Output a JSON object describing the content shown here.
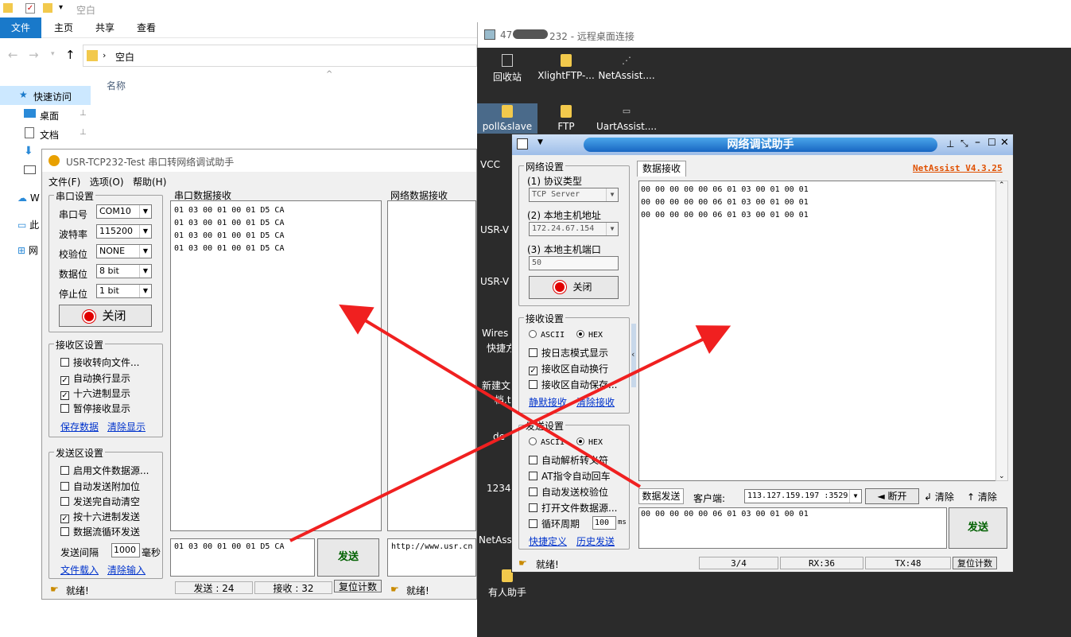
{
  "explorer": {
    "title": "空白",
    "tabs": [
      "文件",
      "主页",
      "共享",
      "查看"
    ],
    "breadcrumb": "空白",
    "column_header": "名称",
    "nav": [
      {
        "label": "快速访问"
      },
      {
        "label": "桌面"
      },
      {
        "label": "文档"
      }
    ],
    "nav_partial": [
      "W",
      "此",
      "网"
    ]
  },
  "usr": {
    "title": "USR-TCP232-Test 串口转网络调试助手",
    "menu": [
      "文件(F)",
      "选项(O)",
      "帮助(H)"
    ],
    "serial_group": "串口设置",
    "port_label": "串口号",
    "port": "COM10",
    "baud_label": "波特率",
    "baud": "115200",
    "parity_label": "校验位",
    "parity": "NONE",
    "data_label": "数据位",
    "data_bits": "8 bit",
    "stop_label": "停止位",
    "stop_bits": "1 bit",
    "close_label": "关闭",
    "recv_group": "接收区设置",
    "recv_opts": [
      {
        "label": "接收转向文件...",
        "on": false
      },
      {
        "label": "自动换行显示",
        "on": true
      },
      {
        "label": "十六进制显示",
        "on": true
      },
      {
        "label": "暂停接收显示",
        "on": false
      }
    ],
    "save_link": "保存数据",
    "clear_link": "清除显示",
    "send_group": "发送区设置",
    "send_opts": [
      {
        "label": "启用文件数据源...",
        "on": false
      },
      {
        "label": "自动发送附加位",
        "on": false
      },
      {
        "label": "发送完自动清空",
        "on": false
      },
      {
        "label": "按十六进制发送",
        "on": true
      },
      {
        "label": "数据流循环发送",
        "on": false
      }
    ],
    "interval_label": "发送间隔",
    "interval": "1000",
    "interval_unit": "毫秒",
    "load_link": "文件载入",
    "clear_input_link": "清除输入",
    "serial_recv_title": "串口数据接收",
    "serial_recv_lines": [
      "01 03 00 01 00 01 D5 CA",
      "01 03 00 01 00 01 D5 CA",
      "01 03 00 01 00 01 D5 CA",
      "01 03 00 01 00 01 D5 CA"
    ],
    "net_recv_title": "网络数据接收",
    "send_text": "01 03 00 01 00 01 D5 CA",
    "send_btn": "发送",
    "net_send_text": "http://www.usr.cn",
    "status": "就绪!",
    "sent": "发送 : 24",
    "recv": "接收 : 32",
    "reset": "复位计数",
    "status2": "就绪!"
  },
  "rd": {
    "title_prefix": "47",
    "title_suffix": "232 - 远程桌面连接",
    "icons": [
      "回收站",
      "XlightFTP-...",
      "NetAssist....",
      "poll&slave",
      "FTP",
      "UartAssist...."
    ],
    "left_partial": [
      "VCC",
      "USR-V",
      "USR-V",
      "Wires",
      "快捷方",
      "新建文",
      "档.t",
      "de",
      "1234",
      "NetAss",
      "有人助手"
    ]
  },
  "na": {
    "title": "网络调试助手",
    "version": "NetAssist V4.3.25",
    "net_group": "网络设置",
    "proto_label": "(1) 协议类型",
    "proto": "TCP Server",
    "host_label": "(2) 本地主机地址",
    "host": "172.24.67.154",
    "port_label": "(3) 本地主机端口",
    "port": "50",
    "close_label": "关闭",
    "recv_group": "接收设置",
    "ascii": "ASCII",
    "hex": "HEX",
    "recv_opts": [
      {
        "label": "按日志模式显示",
        "on": false
      },
      {
        "label": "接收区自动换行",
        "on": true
      },
      {
        "label": "接收区自动保存...",
        "on": false
      }
    ],
    "recv_link1": "静默接收",
    "recv_link2": "清除接收",
    "send_group": "发送设置",
    "send_opts": [
      {
        "label": "自动解析转义符",
        "on": false
      },
      {
        "label": "AT指令自动回车",
        "on": false
      },
      {
        "label": "自动发送校验位",
        "on": false
      },
      {
        "label": "打开文件数据源...",
        "on": false
      }
    ],
    "loop_label": "循环周期",
    "loop": "100",
    "loop_unit": "ms",
    "send_link1": "快捷定义",
    "send_link2": "历史发送",
    "recv_tab": "数据接收",
    "recv_lines": [
      "00 00 00 00 00 06 01 03 00 01 00 01",
      "00 00 00 00 00 06 01 03 00 01 00 01",
      "00 00 00 00 00 06 01 03 00 01 00 01"
    ],
    "send_tab": "数据发送",
    "client_label": "客户端:",
    "client": "113.127.159.197 :3529",
    "disconnect": "断开",
    "clear1": "清除",
    "clear2": "清除",
    "send_text": "00 00 00 00 00 06 01 03 00 01 00 01",
    "send_btn": "发送",
    "status": "就绪!",
    "count": "3/4",
    "rx": "RX:36",
    "tx": "TX:48",
    "reset": "复位计数"
  }
}
